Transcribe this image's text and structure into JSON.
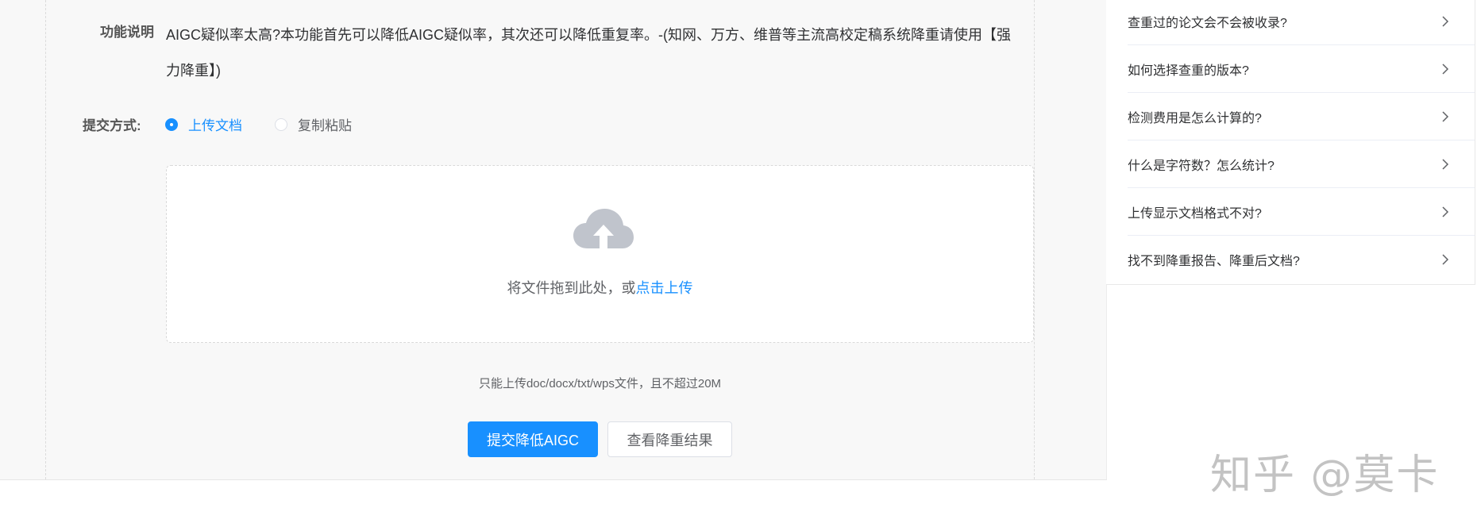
{
  "form": {
    "description_label": "功能说明",
    "description_text": "AIGC疑似率太高?本功能首先可以降低AIGC疑似率，其次还可以降低重复率。-(知网、万方、维普等主流高校定稿系统降重请使用【强力降重】)",
    "method_label": "提交方式:",
    "method_options": [
      {
        "label": "上传文档",
        "selected": true
      },
      {
        "label": "复制粘贴",
        "selected": false
      }
    ]
  },
  "upload": {
    "icon": "cloud-upload-icon",
    "drag_text": "将文件拖到此处，或",
    "click_text": "点击上传",
    "hint": "只能上传doc/docx/txt/wps文件，且不超过20M"
  },
  "actions": {
    "submit_label": "提交降低AIGC",
    "view_label": "查看降重结果"
  },
  "faq": {
    "items": [
      "查重过的论文会不会被收录?",
      "如何选择查重的版本?",
      "检测费用是怎么计算的?",
      "什么是字符数？怎么统计?",
      "上传显示文档格式不对?",
      "找不到降重报告、降重后文档?"
    ],
    "chevron_icon": "chevron-right-icon"
  },
  "watermark": "知乎 @莫卡",
  "colors": {
    "accent": "#1890ff",
    "panel_bg": "#f8f8f8",
    "text": "#303133",
    "muted": "#606266"
  }
}
